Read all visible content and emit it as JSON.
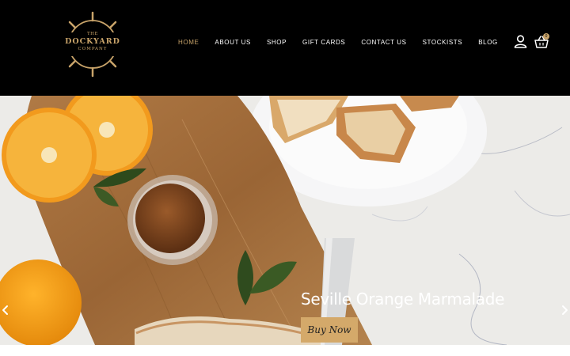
{
  "brand": {
    "the": "THE",
    "name": "DOCKYARD",
    "company": "COMPANY"
  },
  "nav": {
    "items": [
      {
        "label": "HOME",
        "active": true
      },
      {
        "label": "ABOUT US",
        "active": false
      },
      {
        "label": "SHOP",
        "active": false
      },
      {
        "label": "GIFT CARDS",
        "active": false
      },
      {
        "label": "CONTACT US",
        "active": false
      },
      {
        "label": "STOCKISTS",
        "active": false
      },
      {
        "label": "BLOG",
        "active": false
      }
    ]
  },
  "header_icons": {
    "account": "user-icon",
    "cart": "basket-icon",
    "cart_count": "0"
  },
  "slider": {
    "title": "Seville Orange Marmalade",
    "button_label": "Buy Now",
    "prev_icon": "chevron-left-icon",
    "next_icon": "chevron-right-icon"
  },
  "colors": {
    "header_bg": "#000000",
    "accent_gold": "#c9a46a",
    "button_bg": "#d4a96a",
    "nav_text": "#ffffff"
  }
}
